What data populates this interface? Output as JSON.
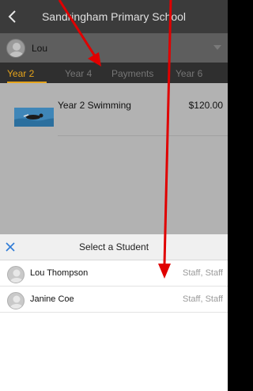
{
  "header": {
    "title": "Sandringham Primary School",
    "back_icon": "chevron-left-icon"
  },
  "user_select": {
    "name": "Lou",
    "avatar_icon": "avatar-icon",
    "dropdown_icon": "chevron-down-icon"
  },
  "tabs": [
    {
      "label": "Year 2",
      "active": true
    },
    {
      "label": "Year 4",
      "active": false
    },
    {
      "label": "Payments",
      "active": false
    },
    {
      "label": "Year 6",
      "active": false
    }
  ],
  "items": [
    {
      "name": "Year 2 Swimming",
      "price": "$120.00",
      "thumbnail_icon": "swimming-photo"
    }
  ],
  "picker": {
    "close_icon": "close-icon",
    "title": "Select a Student",
    "students": [
      {
        "name": "Lou Thompson",
        "role": "Staff, Staff"
      },
      {
        "name": "Janine Coe",
        "role": "Staff, Staff"
      }
    ]
  },
  "colors": {
    "accent_tab": "#e5a31b",
    "header_bg": "#3b3b3b",
    "close_icon": "#2f7bd6",
    "annotation_arrow": "#e00000"
  }
}
